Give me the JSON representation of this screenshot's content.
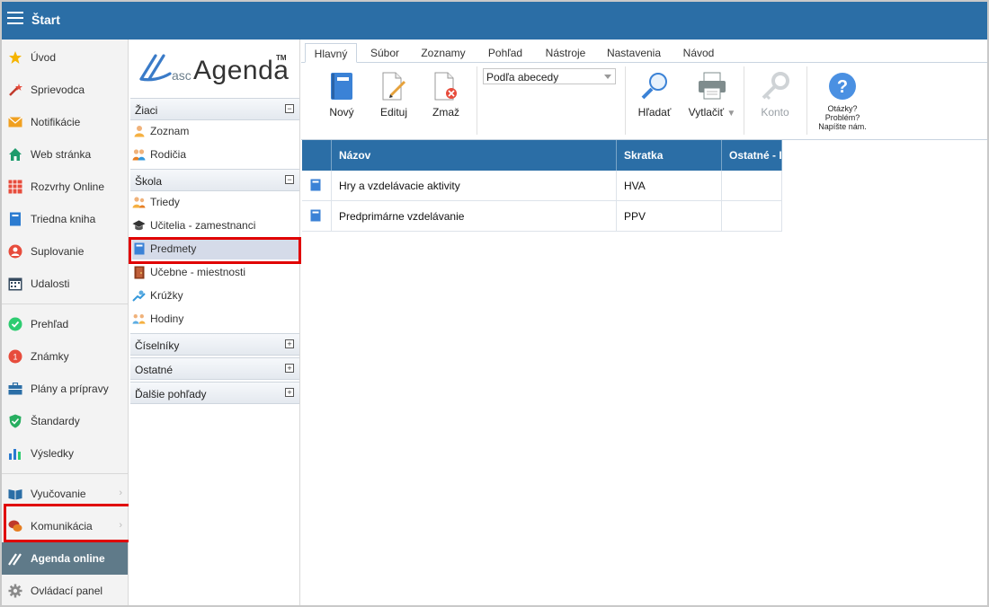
{
  "app": {
    "title": "Štart"
  },
  "left_nav": [
    {
      "label": "Úvod",
      "icon": "star-icon"
    },
    {
      "label": "Sprievodca",
      "icon": "magic-wand-icon"
    },
    {
      "label": "Notifikácie",
      "icon": "envelope-icon"
    },
    {
      "label": "Web stránka",
      "icon": "house-icon"
    },
    {
      "label": "Rozvrhy Online",
      "icon": "calendar-grid-icon"
    },
    {
      "label": "Triedna kniha",
      "icon": "book-icon"
    },
    {
      "label": "Suplovanie",
      "icon": "person-icon"
    },
    {
      "label": "Udalosti",
      "icon": "calendar-icon"
    },
    {
      "label": "Prehľad",
      "icon": "check-circle-icon"
    },
    {
      "label": "Známky",
      "icon": "grade-icon"
    },
    {
      "label": "Plány a prípravy",
      "icon": "briefcase-icon"
    },
    {
      "label": "Štandardy",
      "icon": "shield-icon"
    },
    {
      "label": "Výsledky",
      "icon": "bar-chart-icon"
    },
    {
      "label": "Vyučovanie",
      "icon": "open-book-icon"
    },
    {
      "label": "Komunikácia",
      "icon": "chat-icon"
    },
    {
      "label": "Agenda online",
      "icon": "agenda-icon"
    },
    {
      "label": "Ovládací panel",
      "icon": "gear-icon"
    }
  ],
  "logo": {
    "prefix": "asc",
    "name": "Agenda",
    "tm": "TM"
  },
  "groups": {
    "ziaci": {
      "label": "Žiaci",
      "items": [
        "Zoznam",
        "Rodičia"
      ]
    },
    "skola": {
      "label": "Škola",
      "items": [
        "Triedy",
        "Učitelia - zamestnanci",
        "Predmety",
        "Učebne - miestnosti",
        "Krúžky",
        "Hodiny"
      ]
    },
    "ciselniky": {
      "label": "Číselníky"
    },
    "ostatne": {
      "label": "Ostatné"
    },
    "dalsie": {
      "label": "Ďalšie pohľady"
    }
  },
  "tabs": [
    "Hlavný",
    "Súbor",
    "Zoznamy",
    "Pohľad",
    "Nástroje",
    "Nastavenia",
    "Návod"
  ],
  "ribbon": {
    "new": "Nový",
    "edit": "Edituj",
    "delete": "Zmaž",
    "sort_value": "Podľa abecedy",
    "search": "Hľadať",
    "print": "Vytlačiť",
    "account": "Konto",
    "help_line1": "Otázky?",
    "help_line2": "Problém?",
    "help_line3": "Napíšte nám."
  },
  "table": {
    "columns": [
      "Názov",
      "Skratka",
      "Ostatné - I"
    ],
    "rows": [
      {
        "name": "Hry a vzdelávacie aktivity",
        "abbr": "HVA",
        "other": ""
      },
      {
        "name": "Predprimárne vzdelávanie",
        "abbr": "PPV",
        "other": ""
      }
    ]
  },
  "colors": {
    "brand": "#2b6ea6",
    "highlight": "#e00000",
    "active_nav": "#5f7a89"
  }
}
